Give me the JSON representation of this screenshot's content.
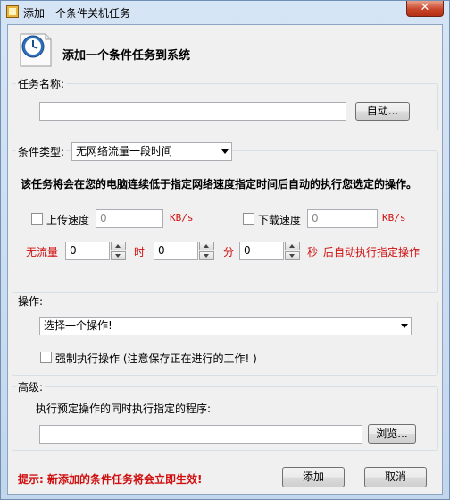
{
  "window": {
    "title": "添加一个条件关机任务",
    "close_label": "✕"
  },
  "header": {
    "title": "添加一个条件任务到系统"
  },
  "task_name": {
    "label": "任务名称:",
    "value": "",
    "auto_button": "自动..."
  },
  "condition": {
    "label": "条件类型:",
    "selected": "无网络流量一段时间",
    "description": "该任务将会在您的电脑连续低于指定网络速度指定时间后自动的执行您选定的操作。",
    "upload": {
      "label": "上传速度",
      "value": "0",
      "unit": "KB/s"
    },
    "download": {
      "label": "下载速度",
      "value": "0",
      "unit": "KB/s"
    },
    "idle": {
      "prefix": "无流量",
      "hours": "0",
      "hours_unit": "时",
      "minutes": "0",
      "minutes_unit": "分",
      "seconds": "0",
      "seconds_unit": "秒",
      "suffix": "后自动执行指定操作"
    }
  },
  "operation": {
    "label": "操作:",
    "selected": "选择一个操作!",
    "force_label": "强制执行操作 (注意保存正在进行的工作! )"
  },
  "advanced": {
    "label": "高级:",
    "program_label": "执行预定操作的同时执行指定的程序:",
    "program_value": "",
    "browse_button": "浏览..."
  },
  "footer": {
    "hint": "提示: 新添加的条件任务将会立即生效!",
    "add_button": "添加",
    "cancel_button": "取消"
  },
  "colors": {
    "hint": "#d01010",
    "unit": "#d01010"
  }
}
